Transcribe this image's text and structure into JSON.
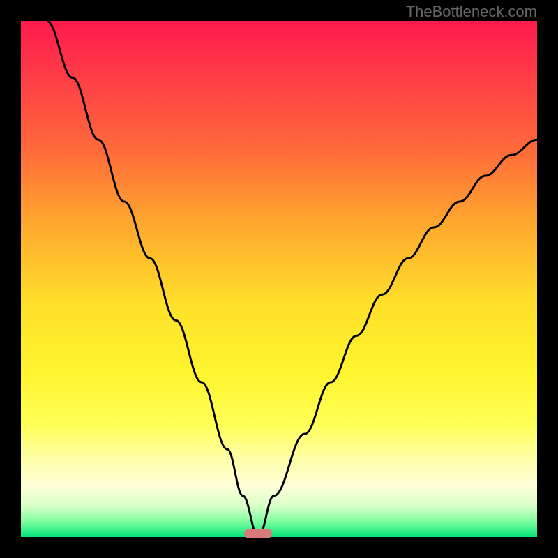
{
  "watermark": "TheBottleneck.com",
  "chart_data": {
    "type": "line",
    "title": "",
    "xlabel": "",
    "ylabel": "",
    "xlim": [
      0,
      100
    ],
    "ylim": [
      0,
      100
    ],
    "curve": {
      "name": "bottleneck-curve",
      "description": "V-shaped bottleneck curve, minimum near x≈46",
      "x": [
        5,
        10,
        15,
        20,
        25,
        30,
        35,
        40,
        43,
        46,
        49,
        55,
        60,
        65,
        70,
        75,
        80,
        85,
        90,
        95,
        100
      ],
      "y": [
        100,
        89,
        77,
        65,
        54,
        42,
        30,
        17,
        8,
        0,
        8,
        20,
        30,
        39,
        47,
        54,
        60,
        65,
        70,
        74,
        77
      ]
    },
    "marker": {
      "x": 46,
      "y": 0,
      "color": "#d97a7a"
    },
    "background_gradient": {
      "top": "#ff1a4d",
      "bottom": "#00e67a",
      "stops": [
        "red",
        "orange",
        "yellow",
        "green"
      ]
    }
  }
}
